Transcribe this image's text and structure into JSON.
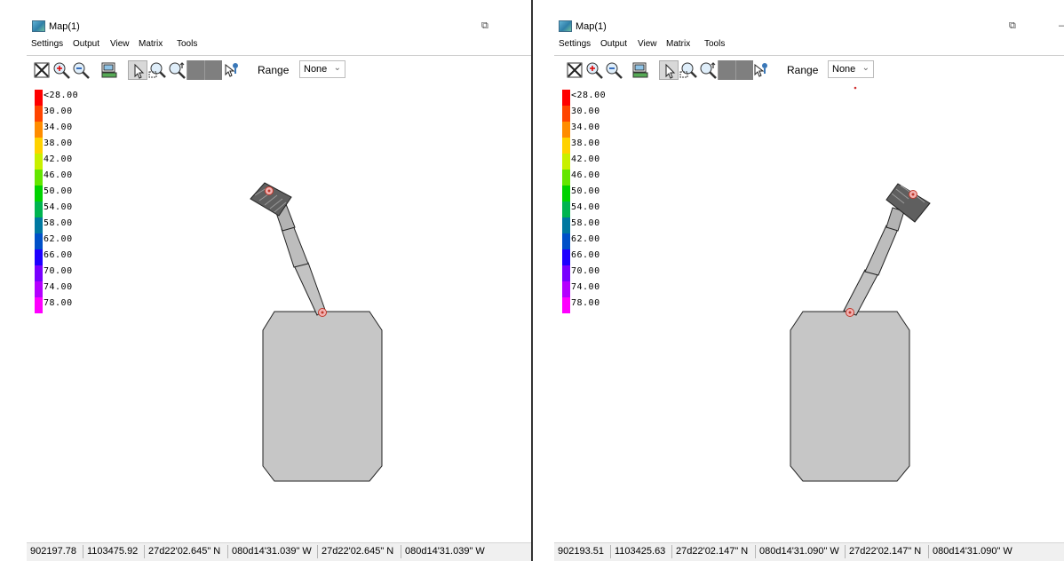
{
  "panels": [
    {
      "window_title": "Map(1)",
      "menu": [
        "Settings",
        "Output",
        "View",
        "Matrix",
        "Tools"
      ],
      "range_label": "Range",
      "range_value": "None",
      "legend": [
        "<28.00",
        "30.00",
        "34.00",
        "38.00",
        "42.00",
        "46.00",
        "50.00",
        "54.00",
        "58.00",
        "62.00",
        "66.00",
        "70.00",
        "74.00",
        "78.00"
      ],
      "status": [
        "902197.78",
        "1103475.92",
        "27d22'02.645\" N",
        "080d14'31.039\" W",
        "27d22'02.645\" N",
        "080d14'31.039\" W"
      ]
    },
    {
      "window_title": "Map(1)",
      "menu": [
        "Settings",
        "Output",
        "View",
        "Matrix",
        "Tools"
      ],
      "range_label": "Range",
      "range_value": "None",
      "legend": [
        "<28.00",
        "30.00",
        "34.00",
        "38.00",
        "42.00",
        "46.00",
        "50.00",
        "54.00",
        "58.00",
        "62.00",
        "66.00",
        "70.00",
        "74.00",
        "78.00"
      ],
      "status": [
        "902193.51",
        "1103425.63",
        "27d22'02.147\" N",
        "080d14'31.090\" W",
        "27d22'02.147\" N",
        "080d14'31.090\" W"
      ]
    }
  ],
  "legend_colors": [
    "#ff0000",
    "#ff4400",
    "#ff8c00",
    "#ffd200",
    "#c8f000",
    "#64e600",
    "#00d200",
    "#00b450",
    "#0078a0",
    "#0050c8",
    "#1e00ff",
    "#7800ff",
    "#b400ff",
    "#ff00ff"
  ],
  "icons": [
    "zoom-extent-icon",
    "zoom-in-icon",
    "zoom-out-icon",
    "layers-icon",
    "pointer-icon",
    "zoom-window-icon",
    "zoom-scale-icon",
    "query-pointer-icon"
  ]
}
